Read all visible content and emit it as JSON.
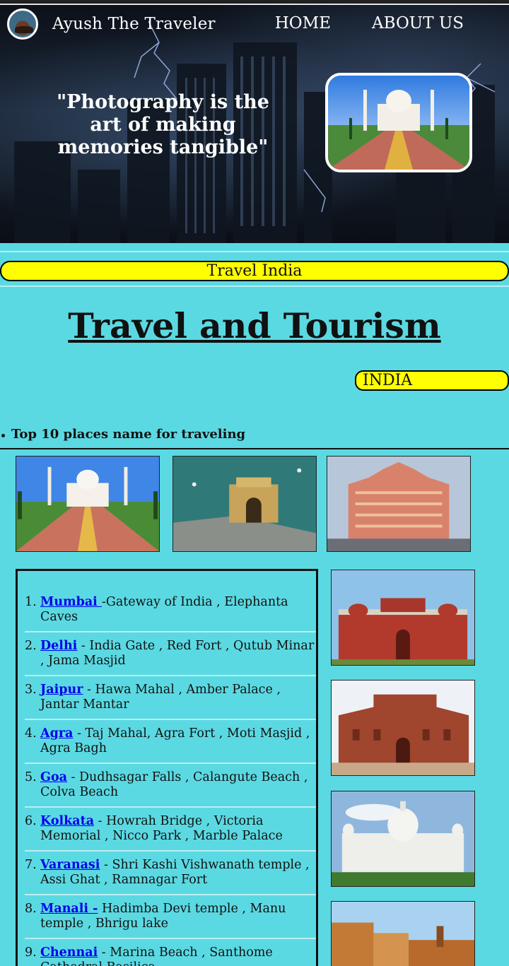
{
  "header": {
    "brand": "Ayush The Traveler",
    "nav": [
      "HOME",
      "ABOUT US"
    ],
    "quote": "\"Photography is the art of making memories tangible\""
  },
  "banner": "Travel India",
  "title": "Travel and Tourism",
  "country_badge": "INDIA",
  "section_heading": "Top 10 places name for traveling",
  "places": [
    {
      "num": "1.",
      "city": "Mumbai ",
      "desc": "-Gateway of India , Elephanta Caves"
    },
    {
      "num": "2.",
      "city": "Delhi",
      "desc": " - India Gate , Red Fort , Qutub Minar , Jama Masjid"
    },
    {
      "num": "3.",
      "city": "Jaipur",
      "desc": " - Hawa Mahal , Amber Palace , Jantar Mantar"
    },
    {
      "num": "4.",
      "city": "Agra",
      "desc": " - Taj Mahal, Agra Fort , Moti Masjid , Agra Bagh"
    },
    {
      "num": "5.",
      "city": "Goa",
      "desc": " - Dudhsagar Falls , Calangute Beach , Colva Beach"
    },
    {
      "num": "6.",
      "city": "Kolkata",
      "desc": " - Howrah Bridge , Victoria Memorial , Nicco Park , Marble Palace"
    },
    {
      "num": "7.",
      "city": "Varanasi",
      "desc": " - Shri Kashi Vishwanath temple , Assi Ghat , Ramnagar Fort"
    },
    {
      "num": "8.",
      "city": "Manali -",
      "desc": " Hadimba Devi temple , Manu temple , Bhrigu lake"
    },
    {
      "num": "9.",
      "city": "Chennai",
      "desc": " - Marina Beach , Santhome Cathedral Basilica"
    }
  ]
}
